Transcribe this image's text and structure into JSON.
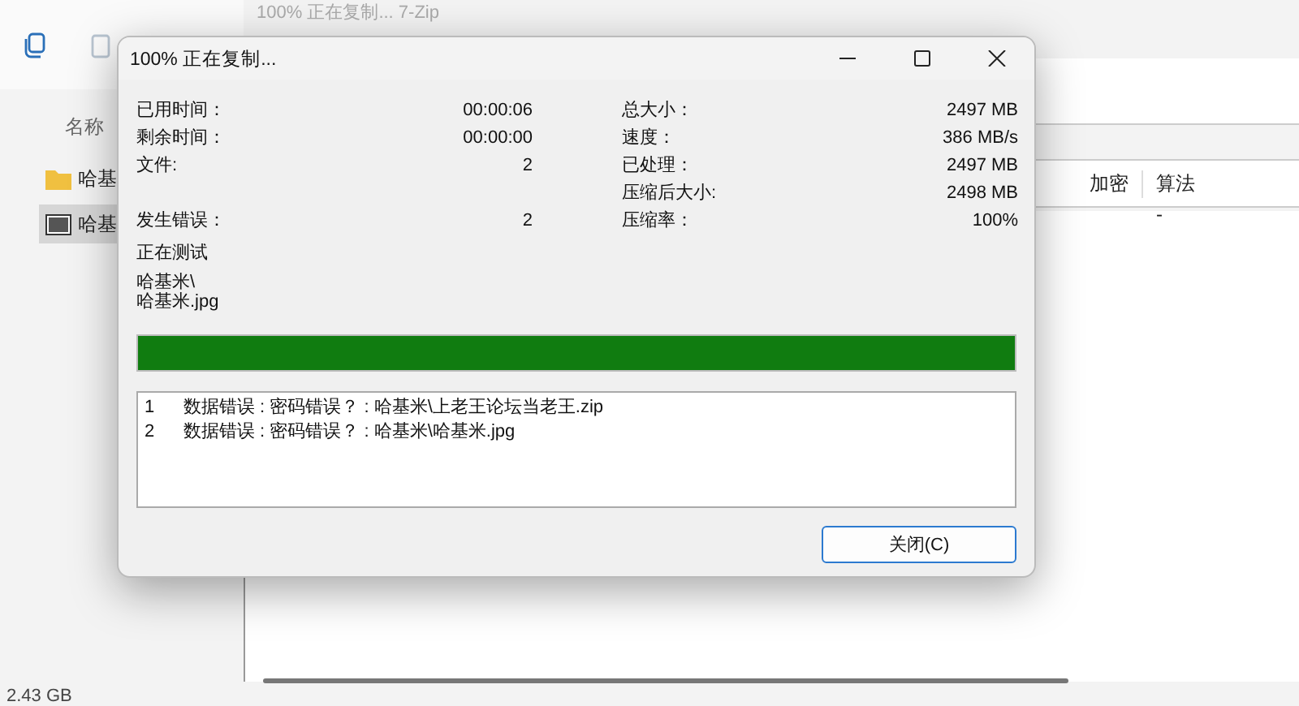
{
  "explorer": {
    "column": "名称",
    "items": [
      {
        "name": "哈基",
        "kind": "folder",
        "selected": false
      },
      {
        "name": "哈基",
        "kind": "archive",
        "selected": true
      }
    ],
    "status": "2.43 GB"
  },
  "background_window": {
    "title": "100% 正在复制... 7-Zip",
    "columns": [
      "加密",
      "算法"
    ],
    "cell": "-"
  },
  "dialog": {
    "title": "100% 正在复制...",
    "stats": [
      {
        "left": {
          "label": "已用时间：",
          "value": "00:00:06"
        },
        "right": {
          "label": "总大小：",
          "value": "2497 MB"
        }
      },
      {
        "left": {
          "label": "剩余时间：",
          "value": "00:00:00"
        },
        "right": {
          "label": "速度：",
          "value": "386 MB/s"
        }
      },
      {
        "left": {
          "label": "文件:",
          "value": "2"
        },
        "right": {
          "label": "已处理：",
          "value": "2497 MB"
        }
      },
      {
        "right": {
          "label": "压缩后大小:",
          "value": "2498 MB"
        }
      },
      {
        "left": {
          "label": "发生错误：",
          "value": "2"
        },
        "right": {
          "label": "压缩率：",
          "value": "100%"
        }
      }
    ],
    "action": "正在测试",
    "path": [
      "哈基米\\",
      "哈基米.jpg"
    ],
    "progress": {
      "level": 1
    },
    "errors": [
      {
        "index": "1",
        "message": "数据错误 : 密码错误？ : 哈基米\\上老王论坛当老王.zip"
      },
      {
        "index": "2",
        "message": "数据错误 : 密码错误？ : 哈基米\\哈基米.jpg"
      }
    ],
    "button": "关闭(C)"
  }
}
